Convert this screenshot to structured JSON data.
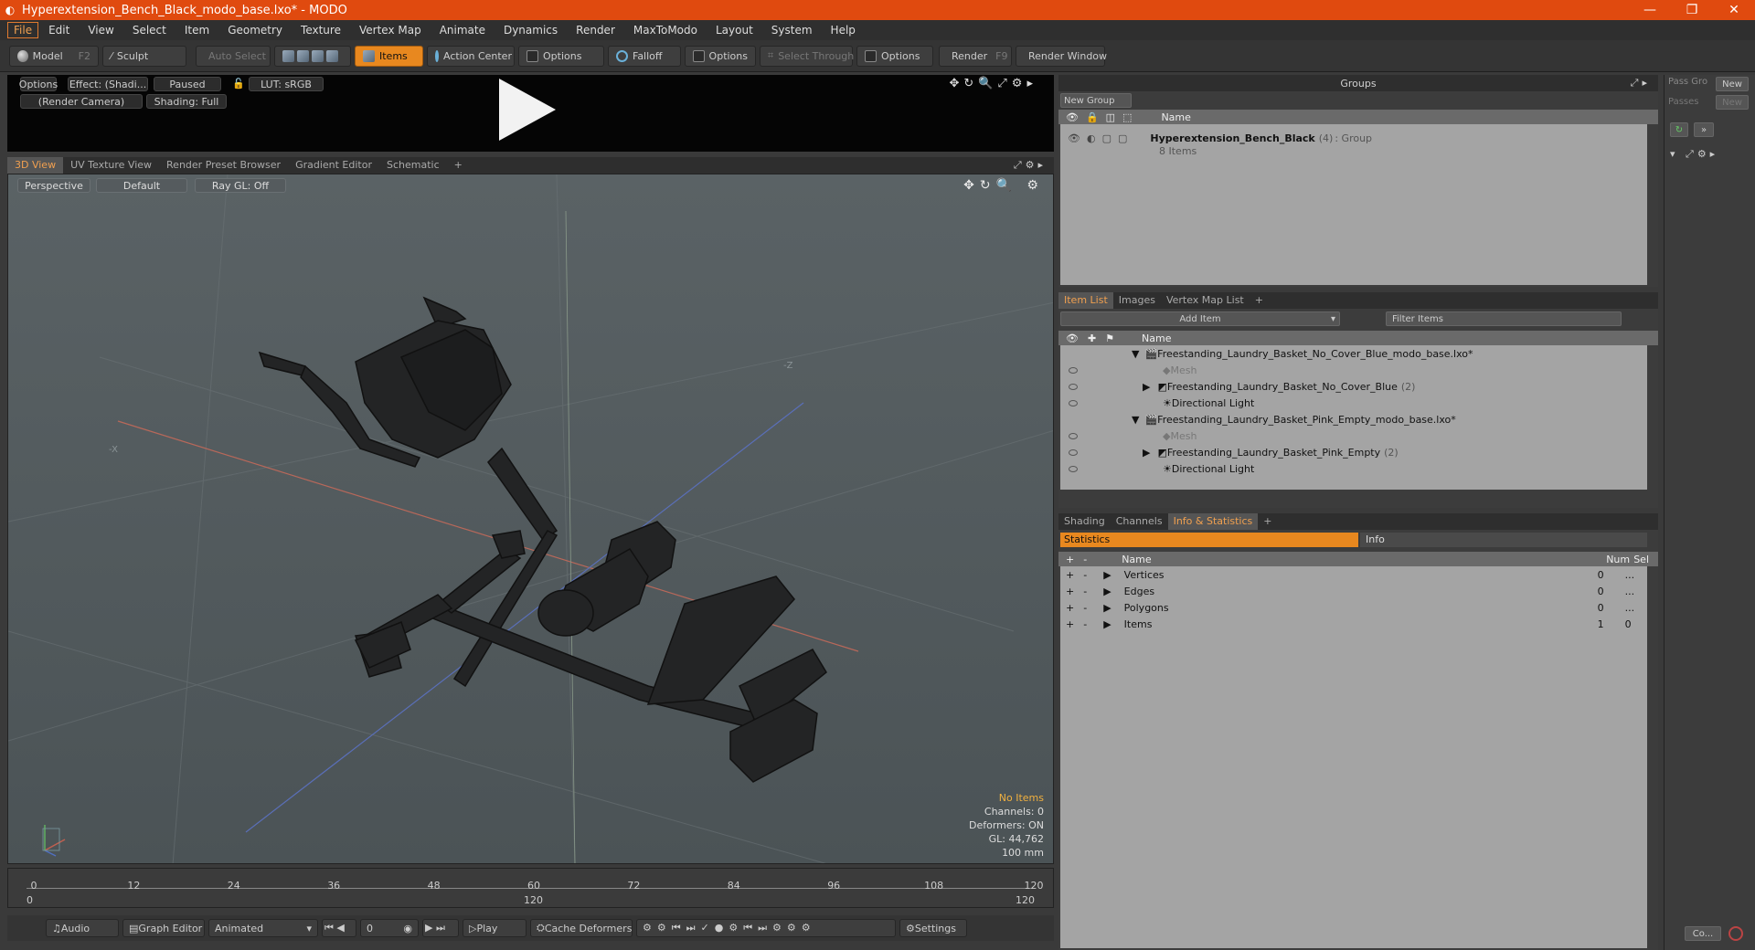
{
  "window": {
    "title": "Hyperextension_Bench_Black_modo_base.lxo* - MODO",
    "min_icon": "minimize-icon",
    "max_icon": "maximize-icon",
    "close_icon": "close-icon"
  },
  "menu": [
    "File",
    "Edit",
    "View",
    "Select",
    "Item",
    "Geometry",
    "Texture",
    "Vertex Map",
    "Animate",
    "Dynamics",
    "Render",
    "MaxToModo",
    "Layout",
    "System",
    "Help"
  ],
  "toolbar": {
    "model": "Model",
    "model_key": "F2",
    "sculpt": "Sculpt",
    "auto_select": "Auto Select",
    "items": "Items",
    "action_center": "Action Center",
    "options1": "Options",
    "falloff": "Falloff",
    "options2": "Options",
    "select_through": "Select Through",
    "options3": "Options",
    "render": "Render",
    "render_key": "F9",
    "render_window": "Render Window"
  },
  "preview": {
    "options": "Options",
    "effect": "Effect: (Shadi...",
    "paused": "Paused",
    "lut": "LUT: sRGB",
    "camera": "(Render Camera)",
    "shading": "Shading: Full"
  },
  "viewport_tabs": [
    "3D View",
    "UV Texture View",
    "Render Preset Browser",
    "Gradient Editor",
    "Schematic"
  ],
  "viewport": {
    "perspective": "Perspective",
    "default": "Default",
    "raygl": "Ray GL: Off",
    "stats": {
      "no_items": "No Items",
      "channels": "Channels: 0",
      "deformers": "Deformers: ON",
      "gl": "GL: 44,762",
      "unit": "100 mm"
    },
    "axis_x": "-X",
    "axis_z": "-Z"
  },
  "timeline": {
    "ticks": [
      "0",
      "12",
      "24",
      "36",
      "48",
      "60",
      "72",
      "84",
      "96",
      "108",
      "120"
    ],
    "range_start": "0",
    "range_mid": "120",
    "range_end": "120"
  },
  "bottombar": {
    "audio": "Audio",
    "graph_editor": "Graph Editor",
    "animated": "Animated",
    "frame": "0",
    "play": "Play",
    "cache_deformers": "Cache Deformers",
    "settings": "Settings"
  },
  "groups": {
    "title": "Groups",
    "new_group": "New Group",
    "col_name": "Name",
    "group_name": "Hyperextension_Bench_Black",
    "group_count": "(4)",
    "group_type": ": Group",
    "group_items": "8 Items"
  },
  "item_list": {
    "tabs": [
      "Item List",
      "Images",
      "Vertex Map List"
    ],
    "add_item": "Add Item",
    "filter": "Filter Items",
    "col_name": "Name",
    "rows": [
      {
        "label": "Freestanding_Laundry_Basket_No_Cover_Blue_modo_base.lxo*",
        "indent": 0,
        "kind": "scene"
      },
      {
        "label": "Mesh",
        "indent": 1,
        "kind": "mesh"
      },
      {
        "label": "Freestanding_Laundry_Basket_No_Cover_Blue",
        "count": "(2)",
        "indent": 1,
        "kind": "item"
      },
      {
        "label": "Directional Light",
        "indent": 1,
        "kind": "light"
      },
      {
        "label": "Freestanding_Laundry_Basket_Pink_Empty_modo_base.lxo*",
        "indent": 0,
        "kind": "scene"
      },
      {
        "label": "Mesh",
        "indent": 1,
        "kind": "mesh"
      },
      {
        "label": "Freestanding_Laundry_Basket_Pink_Empty",
        "count": "(2)",
        "indent": 1,
        "kind": "item"
      },
      {
        "label": "Directional Light",
        "indent": 1,
        "kind": "light"
      }
    ]
  },
  "info": {
    "tabs": [
      "Shading",
      "Channels",
      "Info & Statistics"
    ],
    "statistics": "Statistics",
    "info": "Info",
    "col_name": "Name",
    "col_num": "Num",
    "col_sel": "Sel",
    "rows": [
      {
        "name": "Vertices",
        "num": "0",
        "sel": "..."
      },
      {
        "name": "Edges",
        "num": "0",
        "sel": "..."
      },
      {
        "name": "Polygons",
        "num": "0",
        "sel": "..."
      },
      {
        "name": "Items",
        "num": "1",
        "sel": "0"
      }
    ]
  },
  "far_right": {
    "pass_group": "Pass Gro",
    "new": "New",
    "passes": "Passes",
    "new2": "New",
    "co": "Co..."
  },
  "colors": {
    "accent": "#e8881f",
    "title_bar": "#e04a0f",
    "viewport_bg": "#555d60"
  }
}
